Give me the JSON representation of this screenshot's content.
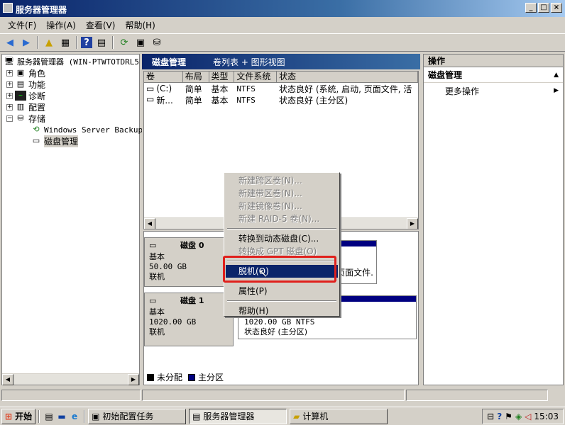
{
  "window": {
    "title": "服务器管理器"
  },
  "menu": [
    "文件(F)",
    "操作(A)",
    "查看(V)",
    "帮助(H)"
  ],
  "tree": {
    "root": "服务器管理器 (WIN-PTWTOTDRL5",
    "items": [
      "角色",
      "功能",
      "诊断",
      "配置",
      "存储"
    ],
    "storage_children": [
      "Windows Server Backup",
      "磁盘管理"
    ]
  },
  "center": {
    "title": "磁盘管理",
    "view": "卷列表 + 图形视图",
    "columns": [
      "卷",
      "布局",
      "类型",
      "文件系统",
      "状态"
    ],
    "rows": [
      {
        "vol": "(C:)",
        "layout": "简单",
        "type": "基本",
        "fs": "NTFS",
        "status": "状态良好 (系统, 启动, 页面文件, 活"
      },
      {
        "vol": "新...",
        "layout": "简单",
        "type": "基本",
        "fs": "NTFS",
        "status": "状态良好 (主分区)"
      }
    ],
    "disks": [
      {
        "name": "磁盘 0",
        "kind": "基本",
        "size": "50.00 GB",
        "state": "联机",
        "part_tail": "页面文件."
      },
      {
        "name": "磁盘 1",
        "kind": "基本",
        "size": "1020.00 GB",
        "state": "联机",
        "part_size": "1020.00 GB NTFS",
        "part_status": "状态良好 (主分区)"
      }
    ],
    "legend": [
      {
        "label": "未分配",
        "color": "#000000"
      },
      {
        "label": "主分区",
        "color": "#000080"
      }
    ]
  },
  "actions": {
    "header": "操作",
    "section": "磁盘管理",
    "more": "更多操作"
  },
  "context_menu": {
    "items": [
      {
        "label": "新建跨区卷(N)...",
        "disabled": true
      },
      {
        "label": "新建带区卷(N)...",
        "disabled": true
      },
      {
        "label": "新建镜像卷(N)...",
        "disabled": true
      },
      {
        "label": "新建 RAID-5 卷(N)...",
        "disabled": true
      },
      {
        "label": "转换到动态磁盘(C)...",
        "disabled": false
      },
      {
        "label": "转换成 GPT 磁盘(O)",
        "disabled": true
      },
      {
        "label": "脱机(O)",
        "disabled": false,
        "highlighted": true
      },
      {
        "label": "属性(P)",
        "disabled": false
      },
      {
        "label": "帮助(H)",
        "disabled": false
      }
    ]
  },
  "taskbar": {
    "start": "开始",
    "tasks": [
      "初始配置任务",
      "服务器管理器",
      "计算机"
    ],
    "clock": "15:03"
  }
}
